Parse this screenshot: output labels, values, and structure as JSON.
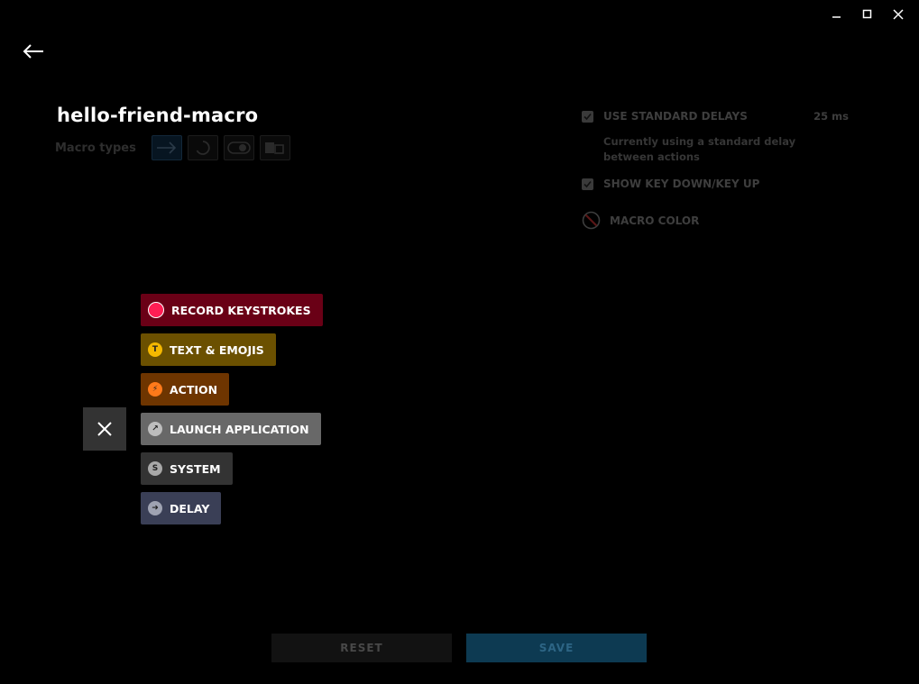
{
  "window_controls": [
    "minimize-icon",
    "maximize-icon",
    "close-icon"
  ],
  "macro": {
    "title": "hello-friend-macro",
    "types_label": "Macro types",
    "type_icons": [
      "arrow-right-icon",
      "loop-icon",
      "toggle-icon",
      "sequence-icon"
    ],
    "active_type": 0
  },
  "settings": {
    "standard_delays": {
      "label": "USE STANDARD DELAYS",
      "value": "25 ms",
      "checked": true
    },
    "delay_description": "Currently using a standard delay between actions",
    "key_down_up": {
      "label": "SHOW KEY DOWN/KEY UP",
      "checked": true
    },
    "macro_color": {
      "label": "MACRO COLOR",
      "icon": "no-color-icon"
    }
  },
  "options": [
    {
      "name": "record-keystrokes",
      "label": "RECORD KEYSTROKES",
      "icon": "record-icon",
      "bg": "#6a0016",
      "icon_bg": "#ff1e54",
      "icon_char": ""
    },
    {
      "name": "text-emojis",
      "label": "TEXT & EMOJIS",
      "icon": "text-icon",
      "bg": "#6b5000",
      "icon_bg": "#f5b800",
      "icon_char": "T"
    },
    {
      "name": "action",
      "label": "ACTION",
      "icon": "lightning-icon",
      "bg": "#6e3500",
      "icon_bg": "#ff7a1a",
      "icon_char": "⚡"
    },
    {
      "name": "launch-application",
      "label": "LAUNCH APPLICATION",
      "icon": "launch-icon",
      "bg": "#686868",
      "icon_bg": "#bdbdbd",
      "icon_char": "↗"
    },
    {
      "name": "system",
      "label": "SYSTEM",
      "icon": "system-icon",
      "bg": "#333333",
      "icon_bg": "#a8a8a8",
      "icon_char": "S"
    },
    {
      "name": "delay",
      "label": "DELAY",
      "icon": "delay-icon",
      "bg": "#3a3f56",
      "icon_bg": "#9fa3b2",
      "icon_char": "➜"
    }
  ],
  "footer": {
    "reset_label": "RESET",
    "save_label": "SAVE"
  },
  "colors": {
    "accent": "#0d3a52",
    "background": "#000000"
  }
}
